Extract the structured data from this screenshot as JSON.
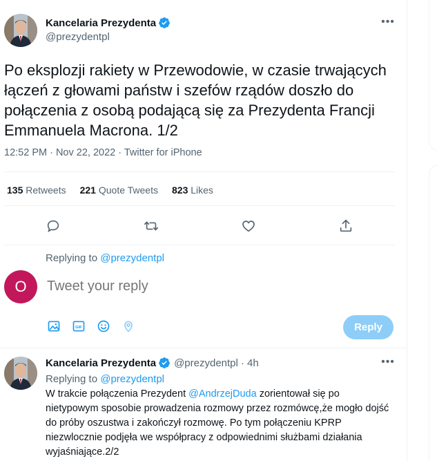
{
  "main_tweet": {
    "author_name": "Kancelaria Prezydenta",
    "author_handle": "@prezydentpl",
    "text": "Po eksplozji rakiety w Przewodowie, w czasie trwających łączeń z głowami państw i szefów rządów doszło do połączenia z osobą podającą się za Prezydenta Francji Emmanuela Macrona. 1/2",
    "timestamp": "12:52 PM · Nov 22, 2022 · Twitter for iPhone",
    "stats": [
      {
        "count": "135",
        "label": "Retweets"
      },
      {
        "count": "221",
        "label": "Quote Tweets"
      },
      {
        "count": "823",
        "label": "Likes"
      }
    ],
    "more_icon": "more-horizontal-icon"
  },
  "composer": {
    "replying_prefix": "Replying to",
    "replying_handle": "@prezydentpl",
    "avatar_letter": "O",
    "placeholder": "Tweet your reply",
    "reply_label": "Reply",
    "avatar_color": "#c2185b",
    "button_color": "#8ecdf8"
  },
  "reply_tweet": {
    "author_name": "Kancelaria Prezydenta",
    "author_handle": "@prezydentpl",
    "time": "· 4h",
    "replying_prefix": "Replying to",
    "replying_handle": "@prezydentpl",
    "text_before": "W trakcie połączenia Prezydent",
    "mention": "@AndrzejDuda",
    "text_after": "zorientował się po nietypowym sposobie prowadzenia rozmowy przez rozmówcę,że mogło dojść do próby oszustwa i zakończył rozmowę. Po tym połączeniu KPRP niezwlocznie podjęła we współpracy z odpowiednimi służbami działania wyjaśniające.2/2"
  },
  "colors": {
    "accent": "#1d9bf0",
    "muted_text": "#536471",
    "divider": "#eff3f4"
  }
}
